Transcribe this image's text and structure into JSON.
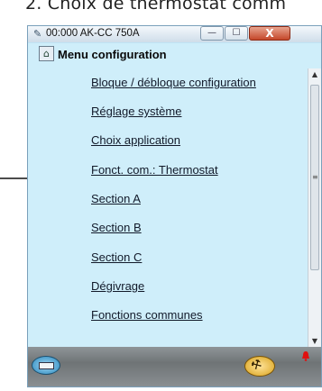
{
  "caption": "2. Choix de thermostat comm",
  "window": {
    "title": "00:000 AK-CC 750A",
    "title_icon": "wrench-icon",
    "controls": {
      "minimize": "—",
      "maximize": "☐",
      "close": "X"
    }
  },
  "menu": {
    "title": "Menu configuration",
    "items": [
      "Bloque / débloque configuration",
      "Réglage système",
      "Choix application",
      "Fonct. com.: Thermostat",
      "Section A",
      "Section B",
      "Section C",
      "Dégivrage",
      "Fonctions communes"
    ]
  },
  "toolbar": {
    "left_icon": "device-icon",
    "right_icon": "wrench-icon",
    "alarm_icon": "alarm-bell-icon"
  },
  "colors": {
    "panel_bg": "#cfeefa",
    "alarm": "#e01010"
  }
}
